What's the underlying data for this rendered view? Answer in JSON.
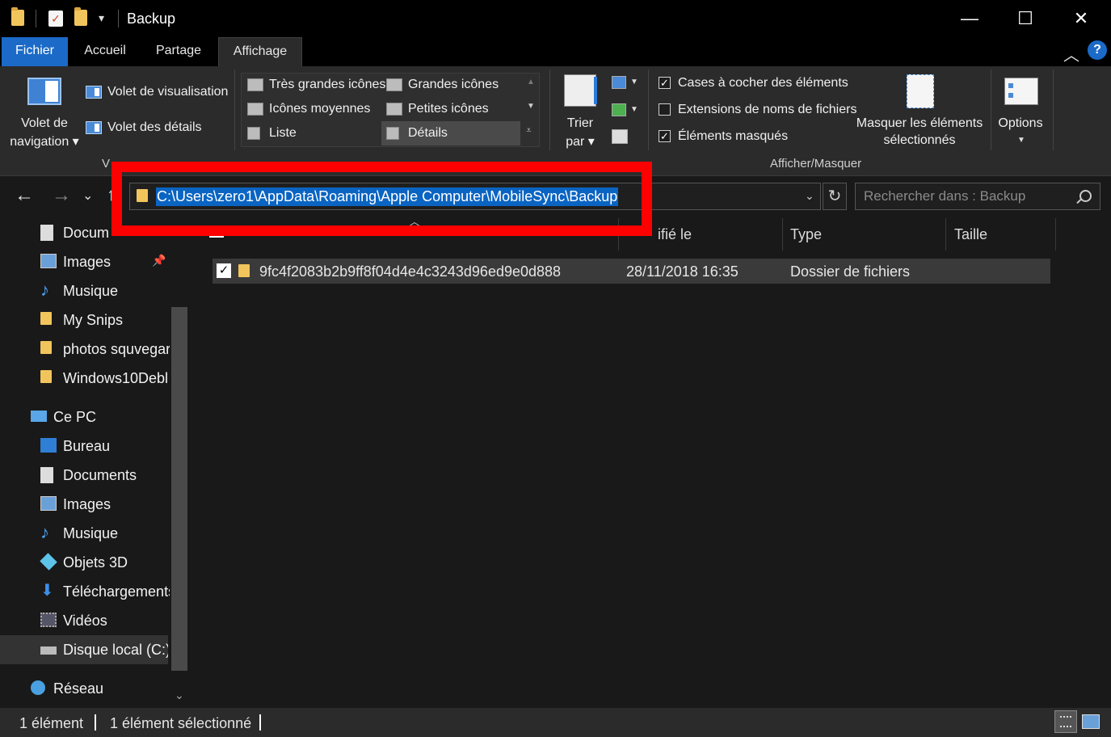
{
  "window": {
    "title": "Backup",
    "controls": {
      "minimize": "—",
      "maximize": "☐",
      "close": "✕"
    }
  },
  "ribbon_tabs": [
    {
      "label": "Fichier"
    },
    {
      "label": "Accueil"
    },
    {
      "label": "Partage"
    },
    {
      "label": "Affichage"
    }
  ],
  "ribbon": {
    "navigation_pane": "Volet de",
    "navigation_pane_2": "navigation",
    "preview_pane": "Volet de visualisation",
    "details_pane": "Volet des détails",
    "layouts": [
      "Très grandes icônes",
      "Grandes icônes",
      "Icônes moyennes",
      "Petites icônes",
      "Liste",
      "Détails"
    ],
    "sort_by": "Trier",
    "sort_by_2": "par",
    "checkbox_items": {
      "label": "Cases à cocher des éléments",
      "checked": true
    },
    "checkbox_extensions": {
      "label": "Extensions de noms de fichiers",
      "checked": false
    },
    "checkbox_hidden": {
      "label": "Éléments masqués",
      "checked": true
    },
    "hide_selected": "Masquer les éléments",
    "hide_selected_2": "sélectionnés",
    "options": "Options",
    "group_show_hide": "Afficher/Masquer",
    "group_panes_partial": "V"
  },
  "address": {
    "path": "C:\\Users\\zero1\\AppData\\Roaming\\Apple Computer\\MobileSync\\Backup",
    "search_placeholder": "Rechercher dans : Backup"
  },
  "nav_pane": {
    "quick_access": [
      {
        "label": "Docum",
        "icon": "document-icon"
      },
      {
        "label": "Images",
        "icon": "image-icon",
        "pinned": true
      },
      {
        "label": "Musique",
        "icon": "music-icon"
      },
      {
        "label": "My Snips",
        "icon": "folder-icon"
      },
      {
        "label": "photos squvegar",
        "icon": "folder-icon"
      },
      {
        "label": "Windows10Debl",
        "icon": "folder-icon"
      }
    ],
    "this_pc": "Ce PC",
    "pc_items": [
      {
        "label": "Bureau",
        "icon": "desktop-icon"
      },
      {
        "label": "Documents",
        "icon": "document-icon"
      },
      {
        "label": "Images",
        "icon": "image-icon"
      },
      {
        "label": "Musique",
        "icon": "music-icon"
      },
      {
        "label": "Objets 3D",
        "icon": "cube-icon"
      },
      {
        "label": "Téléchargements",
        "icon": "download-icon"
      },
      {
        "label": "Vidéos",
        "icon": "video-icon"
      },
      {
        "label": "Disque local (C:)",
        "icon": "drive-icon",
        "selected": true
      }
    ],
    "network": "Réseau"
  },
  "columns": {
    "modified": "ifié le",
    "type": "Type",
    "size": "Taille"
  },
  "files": [
    {
      "name": "9fc4f2083b2b9ff8f04d4e4c3243d96ed9e0d888",
      "modified": "28/11/2018 16:35",
      "type": "Dossier de fichiers",
      "checked": true
    }
  ],
  "status": {
    "count": "1 élément",
    "selected": "1 élément sélectionné"
  },
  "colors": {
    "accent": "#1b6ac7",
    "selection": "#0a64c2",
    "highlight": "#ff0000",
    "folder": "#f2c55c"
  }
}
